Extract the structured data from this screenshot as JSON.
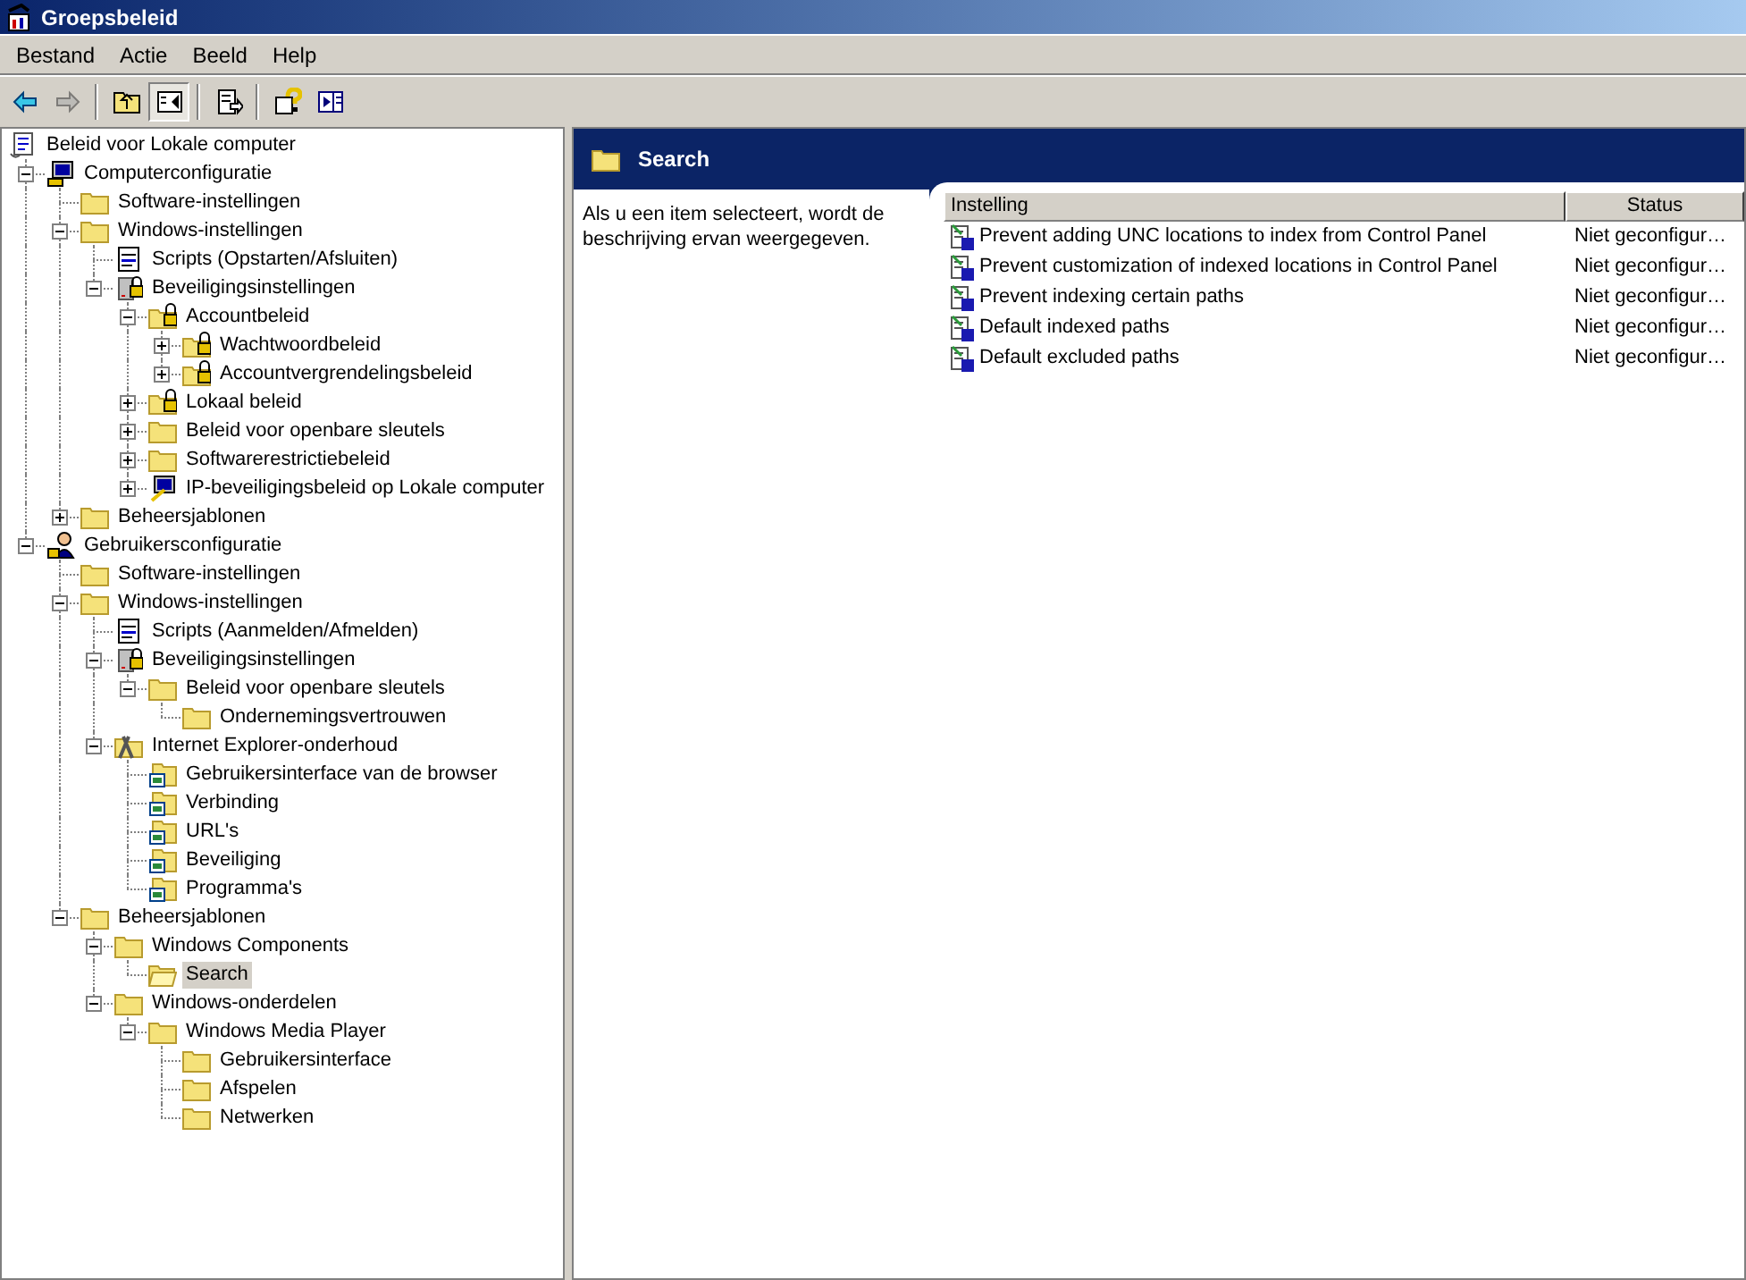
{
  "window": {
    "title": "Groepsbeleid"
  },
  "menu": [
    "Bestand",
    "Actie",
    "Beeld",
    "Help"
  ],
  "toolbar": [
    {
      "kind": "back",
      "disabled": false,
      "pressed": false
    },
    {
      "kind": "forward",
      "disabled": true,
      "pressed": false
    },
    {
      "kind": "up",
      "disabled": false,
      "pressed": false
    },
    {
      "kind": "tree",
      "disabled": false,
      "pressed": true
    },
    {
      "kind": "export",
      "disabled": false,
      "pressed": false
    },
    {
      "kind": "help",
      "disabled": false,
      "pressed": false
    },
    {
      "kind": "panel",
      "disabled": false,
      "pressed": false
    }
  ],
  "tree": {
    "label": "Beleid voor Lokale computer",
    "kind": "scroll",
    "selected": false,
    "children": [
      {
        "label": "Computerconfiguratie",
        "kind": "computer",
        "expanded": true,
        "selected": false,
        "children": [
          {
            "label": "Software-instellingen",
            "kind": "folder",
            "selected": false
          },
          {
            "label": "Windows-instellingen",
            "kind": "folder",
            "expanded": true,
            "selected": false,
            "children": [
              {
                "label": "Scripts (Opstarten/Afsluiten)",
                "kind": "script",
                "selected": false
              },
              {
                "label": "Beveiligingsinstellingen",
                "kind": "server-lock",
                "expanded": true,
                "selected": false,
                "children": [
                  {
                    "label": "Accountbeleid",
                    "kind": "lock-folder",
                    "expanded": true,
                    "selected": false,
                    "children": [
                      {
                        "label": "Wachtwoordbeleid",
                        "kind": "lock-folder",
                        "expanded": false,
                        "selected": false
                      },
                      {
                        "label": "Accountvergrendelingsbeleid",
                        "kind": "lock-folder",
                        "expanded": false,
                        "selected": false
                      }
                    ]
                  },
                  {
                    "label": "Lokaal beleid",
                    "kind": "lock-folder",
                    "expanded": false,
                    "selected": false
                  },
                  {
                    "label": "Beleid voor openbare sleutels",
                    "kind": "folder",
                    "expanded": false,
                    "selected": false
                  },
                  {
                    "label": "Softwarerestrictiebeleid",
                    "kind": "folder",
                    "expanded": false,
                    "selected": false
                  },
                  {
                    "label": "IP-beveiligingsbeleid op Lokale computer",
                    "kind": "monitor-key",
                    "expanded": false,
                    "selected": false
                  }
                ]
              }
            ]
          },
          {
            "label": "Beheersjablonen",
            "kind": "folder",
            "expanded": false,
            "selected": false
          }
        ]
      },
      {
        "label": "Gebruikersconfiguratie",
        "kind": "user",
        "expanded": true,
        "selected": false,
        "children": [
          {
            "label": "Software-instellingen",
            "kind": "folder",
            "selected": false
          },
          {
            "label": "Windows-instellingen",
            "kind": "folder",
            "expanded": true,
            "selected": false,
            "children": [
              {
                "label": "Scripts (Aanmelden/Afmelden)",
                "kind": "script",
                "selected": false
              },
              {
                "label": "Beveiligingsinstellingen",
                "kind": "server-lock",
                "expanded": true,
                "selected": false,
                "children": [
                  {
                    "label": "Beleid voor openbare sleutels",
                    "kind": "folder",
                    "expanded": true,
                    "selected": false,
                    "children": [
                      {
                        "label": "Ondernemingsvertrouwen",
                        "kind": "folder",
                        "selected": false
                      }
                    ]
                  }
                ]
              },
              {
                "label": "Internet Explorer-onderhoud",
                "kind": "tools",
                "expanded": true,
                "selected": false,
                "children": [
                  {
                    "label": "Gebruikersinterface van de browser",
                    "kind": "badge-folder",
                    "selected": false
                  },
                  {
                    "label": "Verbinding",
                    "kind": "badge-folder",
                    "selected": false
                  },
                  {
                    "label": "URL's",
                    "kind": "badge-folder",
                    "selected": false
                  },
                  {
                    "label": "Beveiliging",
                    "kind": "badge-folder",
                    "selected": false
                  },
                  {
                    "label": "Programma's",
                    "kind": "badge-folder",
                    "selected": false
                  }
                ]
              }
            ]
          },
          {
            "label": "Beheersjablonen",
            "kind": "folder",
            "expanded": true,
            "selected": false,
            "children": [
              {
                "label": "Windows Components",
                "kind": "folder",
                "expanded": true,
                "selected": false,
                "children": [
                  {
                    "label": "Search",
                    "kind": "open-folder",
                    "selected": true
                  }
                ]
              },
              {
                "label": "Windows-onderdelen",
                "kind": "folder",
                "expanded": true,
                "selected": false,
                "children": [
                  {
                    "label": "Windows Media Player",
                    "kind": "folder",
                    "expanded": true,
                    "selected": false,
                    "children": [
                      {
                        "label": "Gebruikersinterface",
                        "kind": "folder",
                        "selected": false
                      },
                      {
                        "label": "Afspelen",
                        "kind": "folder",
                        "selected": false
                      },
                      {
                        "label": "Netwerken",
                        "kind": "folder",
                        "selected": false
                      }
                    ]
                  }
                ]
              }
            ]
          }
        ]
      }
    ]
  },
  "details": {
    "title": "Search",
    "description": "Als u een item selecteert, wordt de beschrijving ervan weergegeven.",
    "columns": [
      "Instelling",
      "Status"
    ],
    "rows": [
      {
        "setting": "Prevent adding UNC locations to index from Control Panel",
        "status": "Niet geconfigur…"
      },
      {
        "setting": "Prevent customization of indexed locations in Control Panel",
        "status": "Niet geconfigur…"
      },
      {
        "setting": "Prevent indexing certain paths",
        "status": "Niet geconfigur…"
      },
      {
        "setting": "Default indexed paths",
        "status": "Niet geconfigur…"
      },
      {
        "setting": "Default excluded paths",
        "status": "Niet geconfigur…"
      }
    ]
  }
}
